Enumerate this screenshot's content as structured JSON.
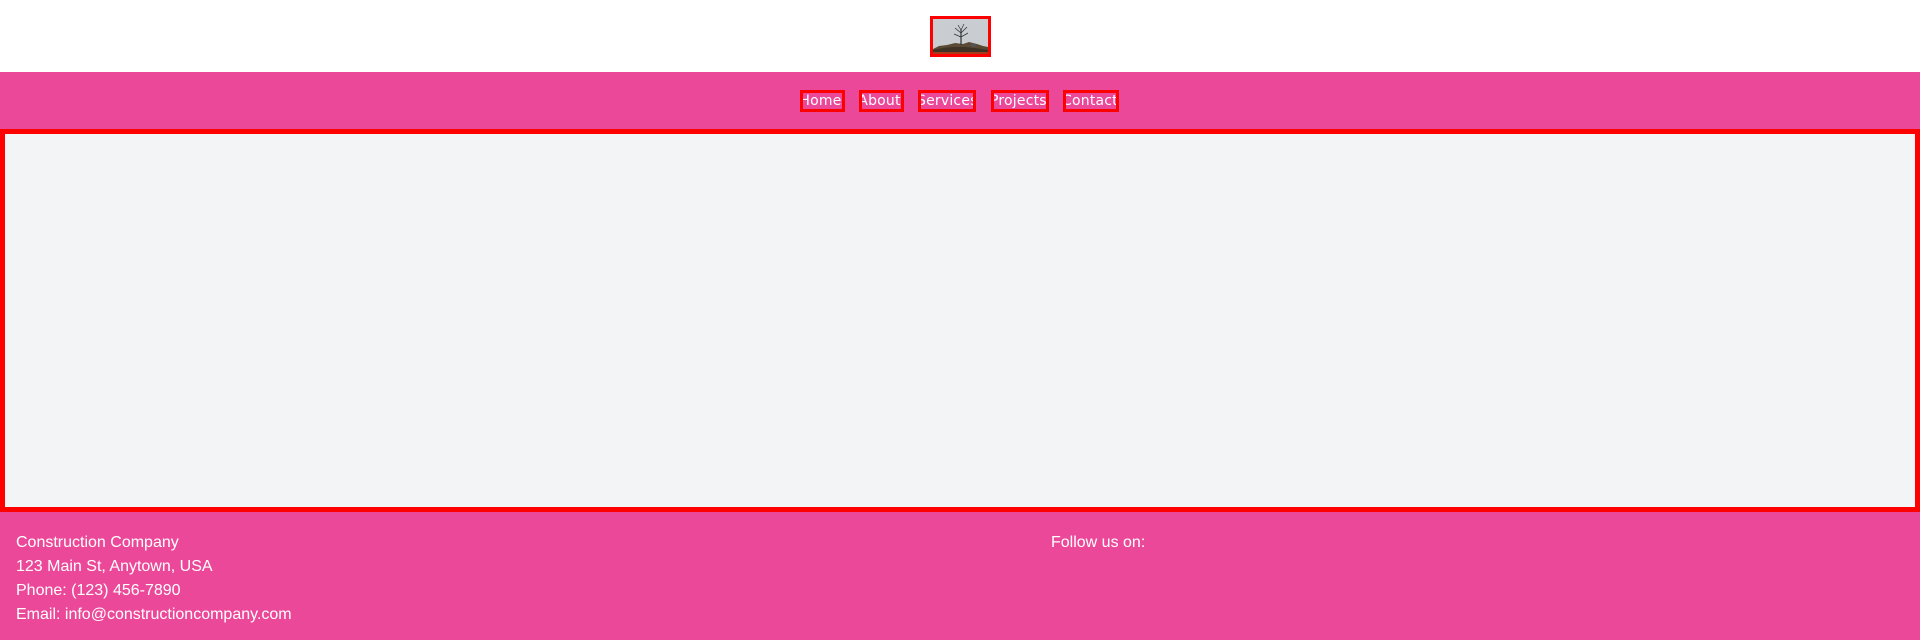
{
  "header": {
    "logo_icon": "tree-on-rock-image"
  },
  "nav": {
    "items": [
      {
        "label": "Home"
      },
      {
        "label": "About"
      },
      {
        "label": "Services"
      },
      {
        "label": "Projects"
      },
      {
        "label": "Contact"
      }
    ]
  },
  "footer": {
    "company_name": "Construction Company",
    "address": "123 Main St, Anytown, USA",
    "phone": "Phone: (123) 456-7890",
    "email": "Email: info@constructioncompany.com",
    "follow_label": "Follow us on:"
  },
  "colors": {
    "brand_pink": "#ec4899",
    "highlight_red": "#ff0000",
    "main_bg": "#f3f4f6"
  }
}
